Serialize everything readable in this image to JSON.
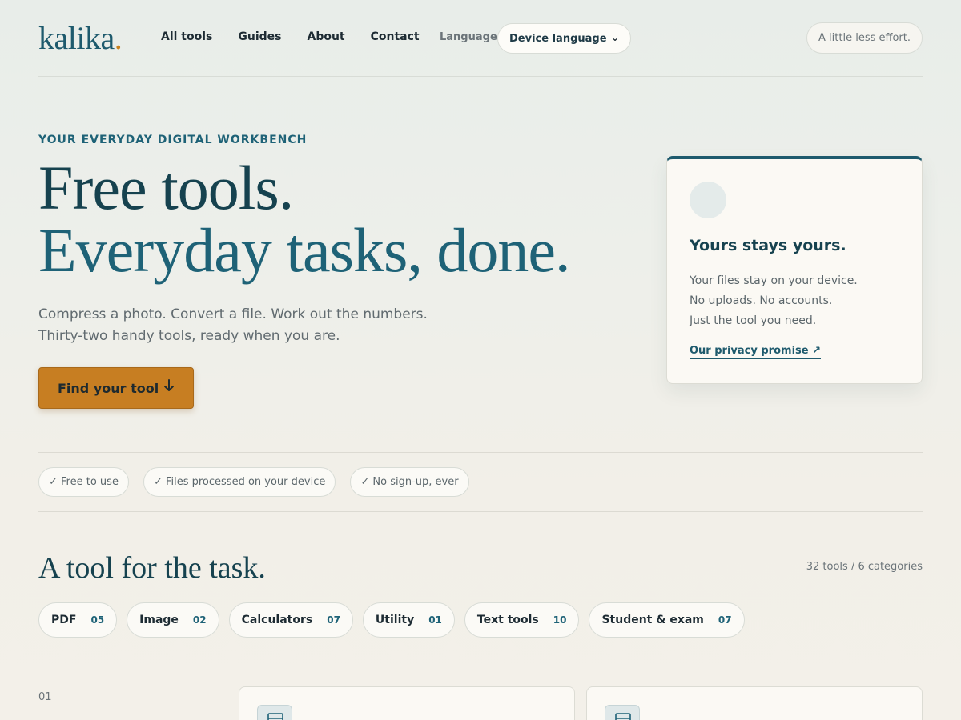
{
  "header": {
    "logo_text": "kalika",
    "logo_dot": ".",
    "nav": [
      "All tools",
      "Guides",
      "About",
      "Contact"
    ],
    "language_label": "Language",
    "language_value": "Device language",
    "tagline": "A little less effort."
  },
  "hero": {
    "eyebrow": "YOUR EVERYDAY DIGITAL WORKBENCH",
    "title_line1": "Free tools.",
    "title_line2": "Everyday tasks, done.",
    "lede_line1": "Compress a photo. Convert a file. Work out the numbers.",
    "lede_line2": "Thirty-two handy tools, ready when you are.",
    "cta_label": "Find your tool",
    "cta_icon": "arrow-down-icon"
  },
  "privacy_card": {
    "title": "Yours stays yours.",
    "lines": [
      "Your files stay on your device.",
      "No uploads. No accounts.",
      "Just the tool you need."
    ],
    "link": "Our privacy promise ↗"
  },
  "badges": [
    "✓ Free to use",
    "✓ Files processed on your device",
    "✓ No sign-up, ever"
  ],
  "tools_section": {
    "title": "A tool for the task.",
    "count": "32 tools / 6 categories",
    "categories": [
      {
        "name": "PDF",
        "count": "05"
      },
      {
        "name": "Image",
        "count": "02"
      },
      {
        "name": "Calculators",
        "count": "07"
      },
      {
        "name": "Utility",
        "count": "01"
      },
      {
        "name": "Text tools",
        "count": "10"
      },
      {
        "name": "Student & exam",
        "count": "07"
      }
    ],
    "section_number": "01"
  },
  "colors": {
    "accent": "#1e5a6d",
    "cta": "#c77e22",
    "logo_dot": "#c9821f"
  }
}
